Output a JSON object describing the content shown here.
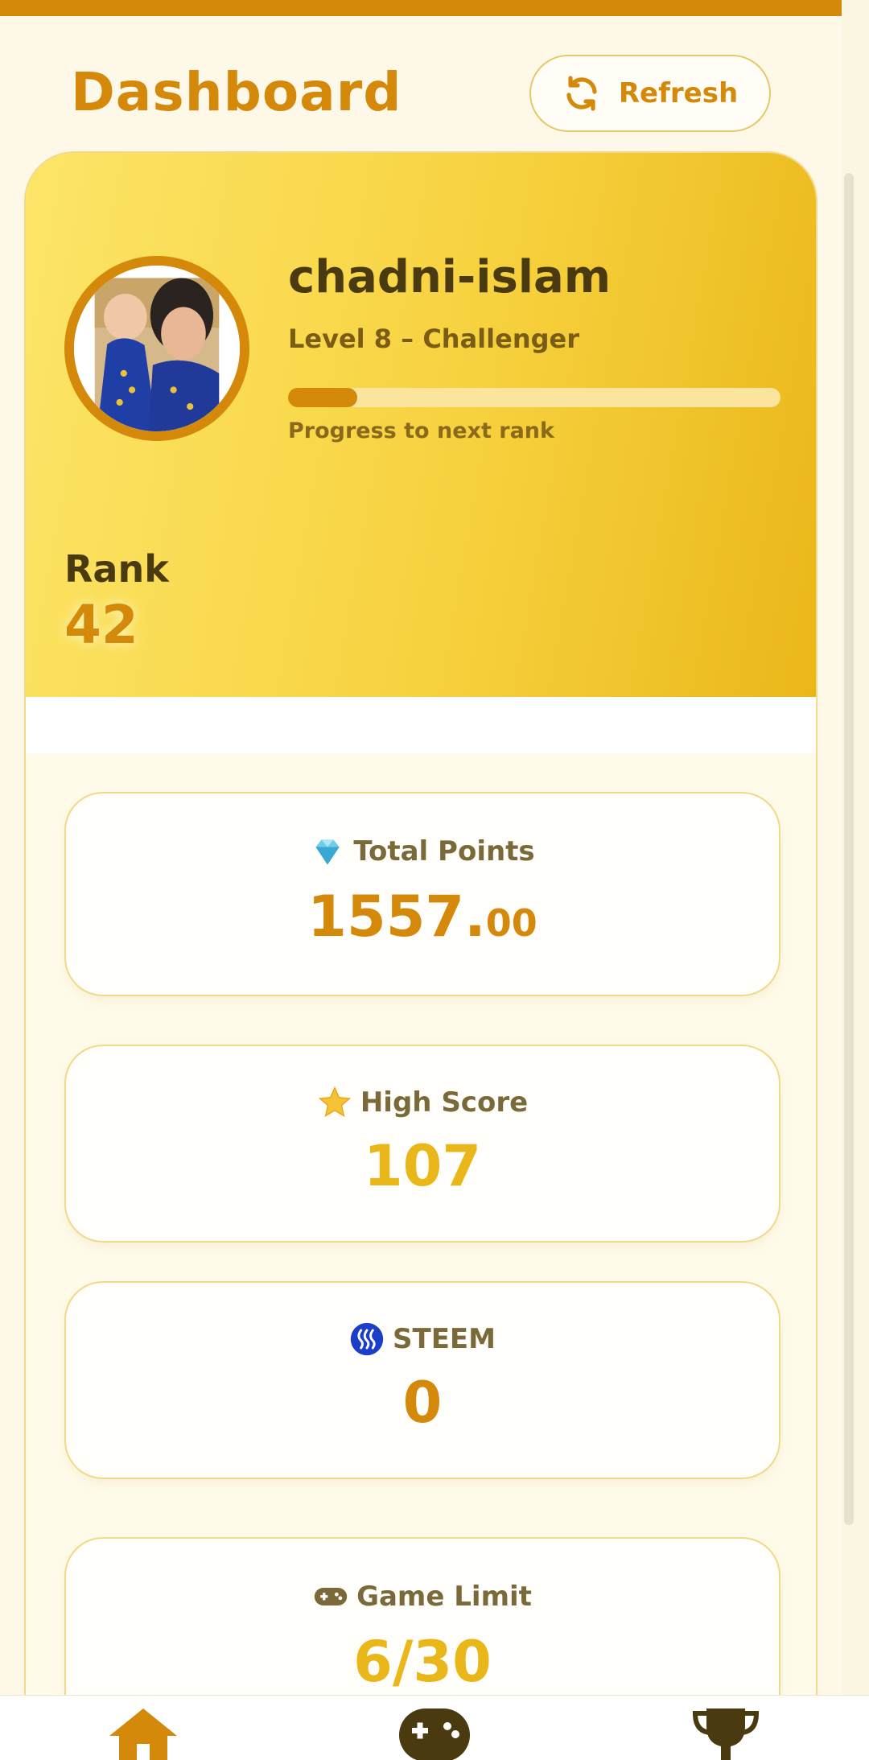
{
  "header": {
    "title": "Dashboard",
    "refresh_label": "Refresh"
  },
  "profile": {
    "username": "chadni-islam",
    "level": "Level 8 – Challenger",
    "progress_label": "Progress to next rank",
    "progress_fraction": 0.14,
    "rank_label": "Rank",
    "rank_value": "42"
  },
  "stats": {
    "points": {
      "label": "Total Points",
      "value_main": "1557.",
      "value_decimal": "00",
      "icon": "diamond-icon"
    },
    "high_score": {
      "label": "High Score",
      "value": "107",
      "icon": "star-icon"
    },
    "steem": {
      "label": "STEEM",
      "value": "0",
      "icon": "steem-icon"
    },
    "game_limit": {
      "label": "Game Limit",
      "value": "6/30",
      "icon": "gamepad-icon"
    }
  },
  "nav": {
    "items": [
      "home-icon",
      "gamepad-icon",
      "trophy-icon"
    ]
  },
  "colors": {
    "accent": "#d4890a",
    "gold": "#eab71a",
    "text_dark": "#4a3a10"
  }
}
